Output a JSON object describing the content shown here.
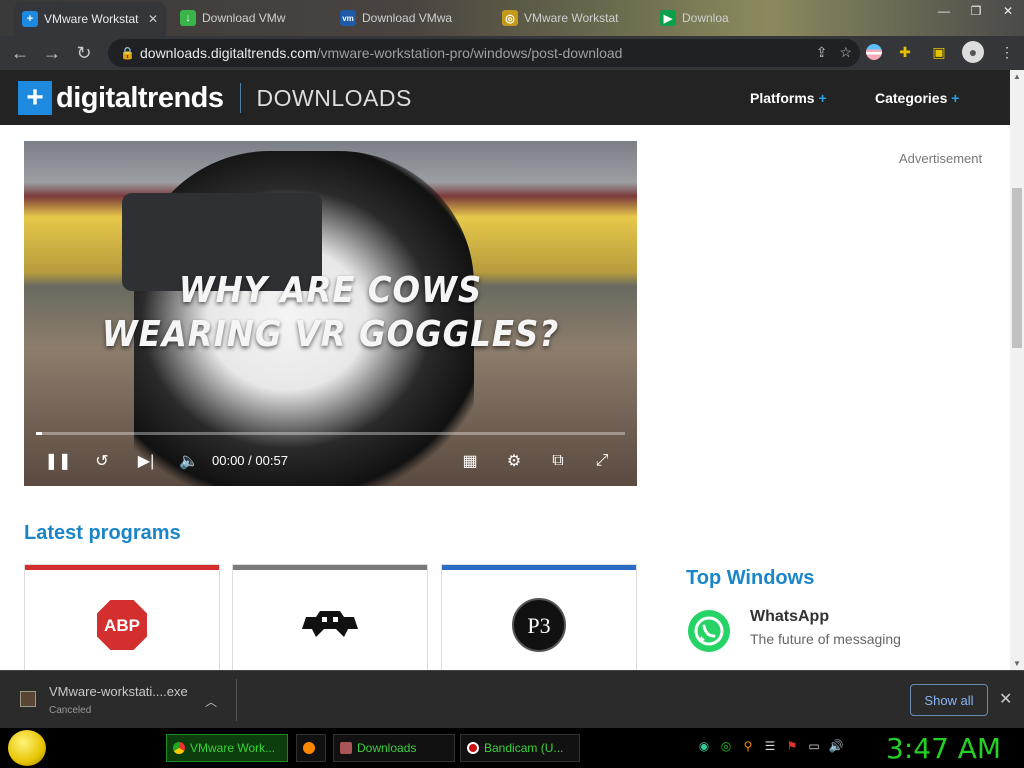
{
  "browser": {
    "tabs": [
      {
        "title": "VMware Workstat",
        "fav": "+",
        "color": "#1d8ae0",
        "active": true
      },
      {
        "title": "Download VMw",
        "fav": "↓",
        "color": "#3ab54a"
      },
      {
        "title": "Download VMwa",
        "fav": "vm",
        "color": "#1e5aa8"
      },
      {
        "title": "VMware Workstat",
        "fav": "◎",
        "color": "#c49a1a"
      },
      {
        "title": "Downloa",
        "fav": "▶",
        "color": "#0aa04a"
      }
    ],
    "url_host": "downloads.digitaltrends.com",
    "url_path": "/vmware-workstation-pro/windows/post-download"
  },
  "site": {
    "logo_text": "digitaltrends",
    "section": "DOWNLOADS",
    "nav": [
      {
        "label": "Platforms",
        "plus": "+"
      },
      {
        "label": "Categories",
        "plus": "+"
      }
    ]
  },
  "video": {
    "caption_line1": "WHY ARE COWS",
    "caption_line2": "WEARING VR GOGGLES?",
    "current_time": "00:00",
    "duration": "00:57",
    "time_sep": "/",
    "progress": 0.01
  },
  "advertisement_label": "Advertisement",
  "latest": {
    "heading": "Latest programs",
    "cards": [
      {
        "icon": "adblock-plus-icon",
        "label": "ABP",
        "accent": "#d32f2f"
      },
      {
        "icon": "retroarch-icon",
        "accent": "#7a7a7a"
      },
      {
        "icon": "p3-icon",
        "label": "P3",
        "accent": "#2b6cc4"
      }
    ]
  },
  "top_windows": {
    "heading": "Top Windows",
    "app_name": "WhatsApp",
    "app_desc": "The future of messaging"
  },
  "download_bar": {
    "file_name": "VMware-workstati....exe",
    "status": "Canceled",
    "show_all": "Show all"
  },
  "taskbar": {
    "items": [
      {
        "label": "VMware Work...",
        "color": "#e33",
        "active": true
      },
      {
        "label": "",
        "color": "#f80"
      },
      {
        "label": "Downloads",
        "color": "#a55"
      },
      {
        "label": "Bandicam (U...",
        "color": "#c11"
      }
    ],
    "clock": "3:47 AM"
  }
}
